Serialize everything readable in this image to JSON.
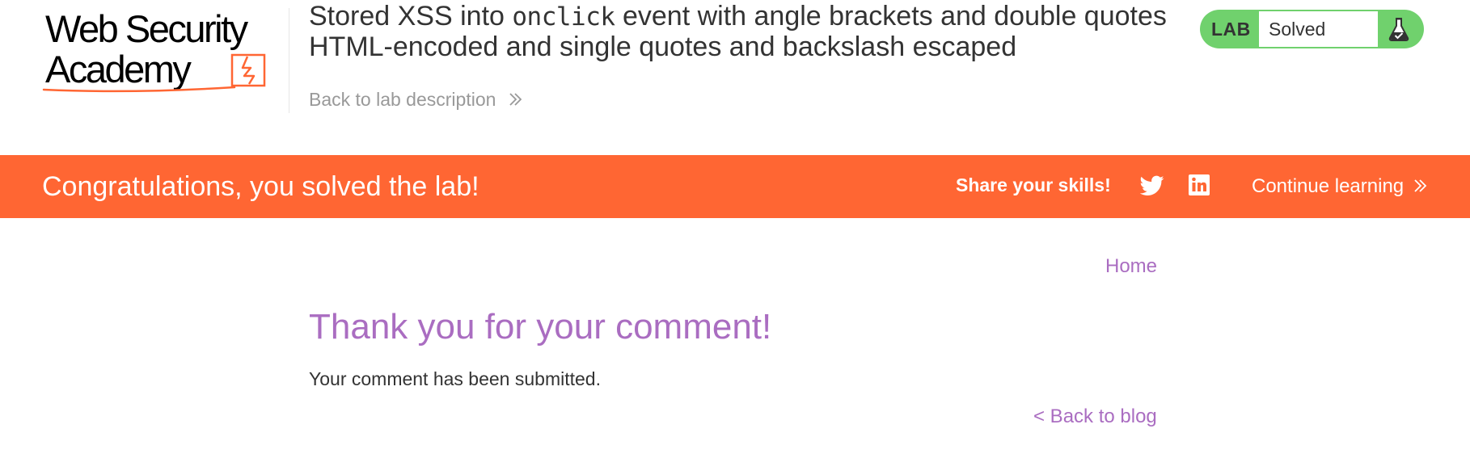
{
  "header": {
    "logo_line1": "Web Security",
    "logo_line2": "Academy",
    "title_before": "Stored XSS into ",
    "title_code": "onclick",
    "title_after": " event with angle brackets and double quotes HTML-encoded and single quotes and backslash escaped",
    "back_to_description": "Back to lab description"
  },
  "lab_badge": {
    "label": "LAB",
    "status": "Solved",
    "icon": "flask-check-icon",
    "color": "#70d16d"
  },
  "banner": {
    "message": "Congratulations, you solved the lab!",
    "share_label": "Share your skills!",
    "social_icons": [
      "twitter-icon",
      "linkedin-icon"
    ],
    "continue_label": "Continue learning",
    "color": "#ff6633"
  },
  "nav": {
    "home_label": "Home"
  },
  "main": {
    "heading": "Thank you for your comment!",
    "message": "Your comment has been submitted.",
    "back_link": "< Back to blog"
  },
  "colors": {
    "accent_orange": "#ff6633",
    "link_purple": "#aa6dc1",
    "text_dark": "#333333",
    "text_muted": "#999999"
  }
}
